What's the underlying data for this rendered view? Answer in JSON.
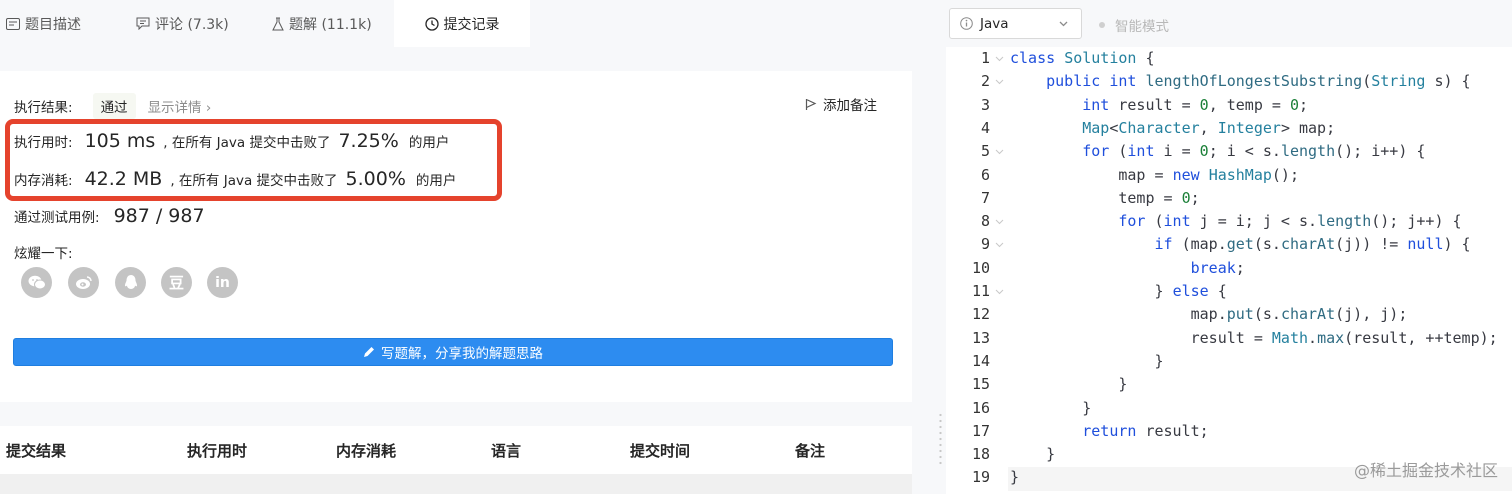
{
  "tabs": [
    {
      "label": "题目描述",
      "icon": "description-icon"
    },
    {
      "label": "评论 (7.3k)",
      "icon": "comment-icon"
    },
    {
      "label": "题解 (11.1k)",
      "icon": "flask-icon"
    },
    {
      "label": "提交记录",
      "icon": "clock-icon"
    }
  ],
  "result": {
    "label": "执行结果:",
    "status": "通过",
    "detail_link": "显示详情 ›",
    "add_note": "添加备注"
  },
  "runtime": {
    "label": "执行用时:",
    "value": "105 ms",
    "text_prefix": ", 在所有 Java 提交中击败了",
    "percent": "7.25%",
    "text_suffix": "的用户"
  },
  "memory": {
    "label": "内存消耗:",
    "value": "42.2 MB",
    "text_prefix": ", 在所有 Java 提交中击败了",
    "percent": "5.00%",
    "text_suffix": "的用户"
  },
  "testcases": {
    "label": "通过测试用例:",
    "value": "987 / 987"
  },
  "share": {
    "label": "炫耀一下:",
    "icons": [
      "wechat-icon",
      "weibo-icon",
      "qq-icon",
      "douban-icon",
      "linkedin-icon"
    ],
    "douban_glyph": "豆",
    "linkedin_glyph": "in"
  },
  "write_button": "写题解，分享我的解题思路",
  "table_headers": [
    "提交结果",
    "执行用时",
    "内存消耗",
    "语言",
    "提交时间",
    "备注"
  ],
  "editor": {
    "language": "Java",
    "smart_mode": "智能模式",
    "line_numbers": [
      "1",
      "2",
      "3",
      "4",
      "5",
      "6",
      "7",
      "8",
      "9",
      "10",
      "11",
      "12",
      "13",
      "14",
      "15",
      "16",
      "17",
      "18",
      "19"
    ]
  },
  "watermark": "@稀土掘金技术社区",
  "colors": {
    "accent_blue": "#2d8cf0",
    "highlight_red": "#e5432d",
    "keyword": "#1f4fdc"
  }
}
